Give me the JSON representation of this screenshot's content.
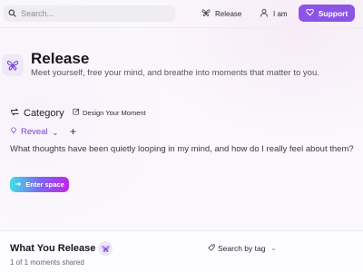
{
  "header": {
    "search_placeholder": "Search...",
    "nav_release": "Release",
    "nav_iam": "I am",
    "support_label": "Support"
  },
  "hero": {
    "title": "Release",
    "subtitle": "Meet yourself, free your mind, and breathe into moments that matter to you."
  },
  "category": {
    "label": "Category",
    "design_link": "Design Your Moment"
  },
  "tabs": {
    "active": "Reveal",
    "add_symbol": "+",
    "chevron": "⌄"
  },
  "question": "What thoughts have been quietly looping in my mind, and how do I really feel about them?",
  "enter_button": "Enter space",
  "release_section": {
    "title": "What You Release",
    "count": "1 of 1 moments shared",
    "search_tag": "Search by tag"
  },
  "colors": {
    "accent": "#8b54e6",
    "gradient_start": "#3fe0ea",
    "gradient_end": "#c126e6"
  },
  "icons": [
    "search-icon",
    "butterfly-icon",
    "user-icon",
    "heart-icon",
    "swap-icon",
    "edit-icon",
    "lightbulb-icon",
    "arrow-right-icon",
    "tag-icon"
  ]
}
